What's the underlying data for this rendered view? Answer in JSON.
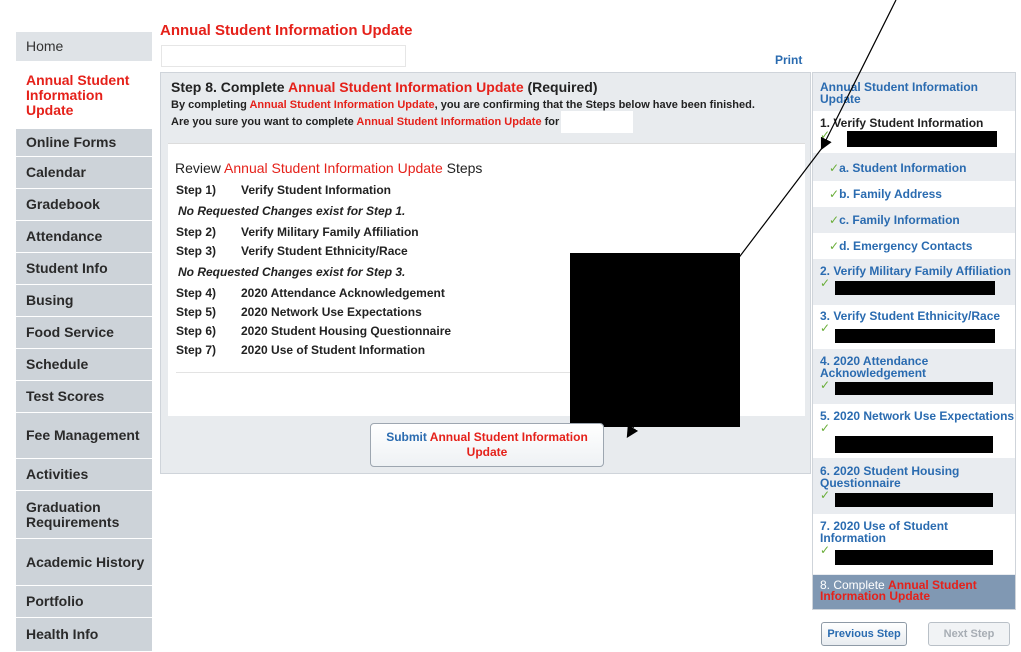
{
  "sidebar": {
    "items": [
      {
        "label": "Home",
        "name": "nav-home"
      },
      {
        "label": "Annual Student Information Update",
        "name": "nav-annual-update"
      },
      {
        "label": "Online Forms",
        "name": "nav-online-forms"
      },
      {
        "label": "Calendar",
        "name": "nav-calendar"
      },
      {
        "label": "Gradebook",
        "name": "nav-gradebook"
      },
      {
        "label": "Attendance",
        "name": "nav-attendance"
      },
      {
        "label": "Student Info",
        "name": "nav-student-info"
      },
      {
        "label": "Busing",
        "name": "nav-busing"
      },
      {
        "label": "Food Service",
        "name": "nav-food-service"
      },
      {
        "label": "Schedule",
        "name": "nav-schedule"
      },
      {
        "label": "Test Scores",
        "name": "nav-test-scores"
      },
      {
        "label": "Fee Management",
        "name": "nav-fee-management"
      },
      {
        "label": "Activities",
        "name": "nav-activities"
      },
      {
        "label": "Graduation Requirements",
        "name": "nav-graduation-requirements"
      },
      {
        "label": "Academic History",
        "name": "nav-academic-history"
      },
      {
        "label": "Portfolio",
        "name": "nav-portfolio"
      },
      {
        "label": "Health Info",
        "name": "nav-health-info"
      }
    ]
  },
  "header": {
    "title": "Annual Student Information Update",
    "print": "Print"
  },
  "main": {
    "step_prefix": "Step 8. Complete ",
    "step_highlight": "Annual Student Information Update",
    "step_suffix": " (Required)",
    "desc1_a": "By completing ",
    "desc1_b": "Annual Student Information Update",
    "desc1_c": ", you are confirming that the Steps below have been finished.",
    "desc2_a": "Are you sure you want to complete ",
    "desc2_b": "Annual Student Information Update",
    "desc2_c": " for",
    "review_a": "Review ",
    "review_b": "Annual Student Information Update",
    "review_c": " Steps",
    "steps": [
      {
        "num": "Step 1)",
        "label": "Verify Student Information"
      },
      {
        "note": "No Requested Changes exist for Step 1."
      },
      {
        "num": "Step 2)",
        "label": "Verify Military Family Affiliation"
      },
      {
        "num": "Step 3)",
        "label": "Verify Student Ethnicity/Race"
      },
      {
        "note": "No Requested Changes exist for Step 3."
      },
      {
        "num": "Step 4)",
        "label": "2020 Attendance Acknowledgement"
      },
      {
        "num": "Step 5)",
        "label": "2020 Network Use Expectations"
      },
      {
        "num": "Step 6)",
        "label": "2020 Student Housing Questionnaire"
      },
      {
        "num": "Step 7)",
        "label": "2020 Use of Student Information"
      }
    ],
    "submit_a": "Submit ",
    "submit_b": "Annual Student Information Update"
  },
  "rightbar": {
    "heading": "Annual Student Information Update",
    "step1": "1. Verify Student Information",
    "sub": [
      "a. Student Information",
      "b. Family Address",
      "c. Family Information",
      "d. Emergency Contacts"
    ],
    "step2": "2. Verify Military Family Affiliation",
    "step3": "3. Verify Student Ethnicity/Race",
    "step4": "4. 2020 Attendance Acknowledgement",
    "step5": "5. 2020 Network Use Expectations",
    "step6": "6. 2020 Student Housing Questionnaire",
    "step7": "7. 2020 Use of Student Information",
    "step8_a": "8. Complete ",
    "step8_b": "Annual Student Information Update",
    "check": "✓"
  },
  "buttons": {
    "previous": "Previous Step",
    "next": "Next Step"
  },
  "colors": {
    "accent_red": "#e5211a",
    "link_blue": "#2a6bb0",
    "sidebar_bg": "#cdd3d9",
    "current_step_bg": "#8098b3",
    "check_green": "#6aae3a"
  }
}
